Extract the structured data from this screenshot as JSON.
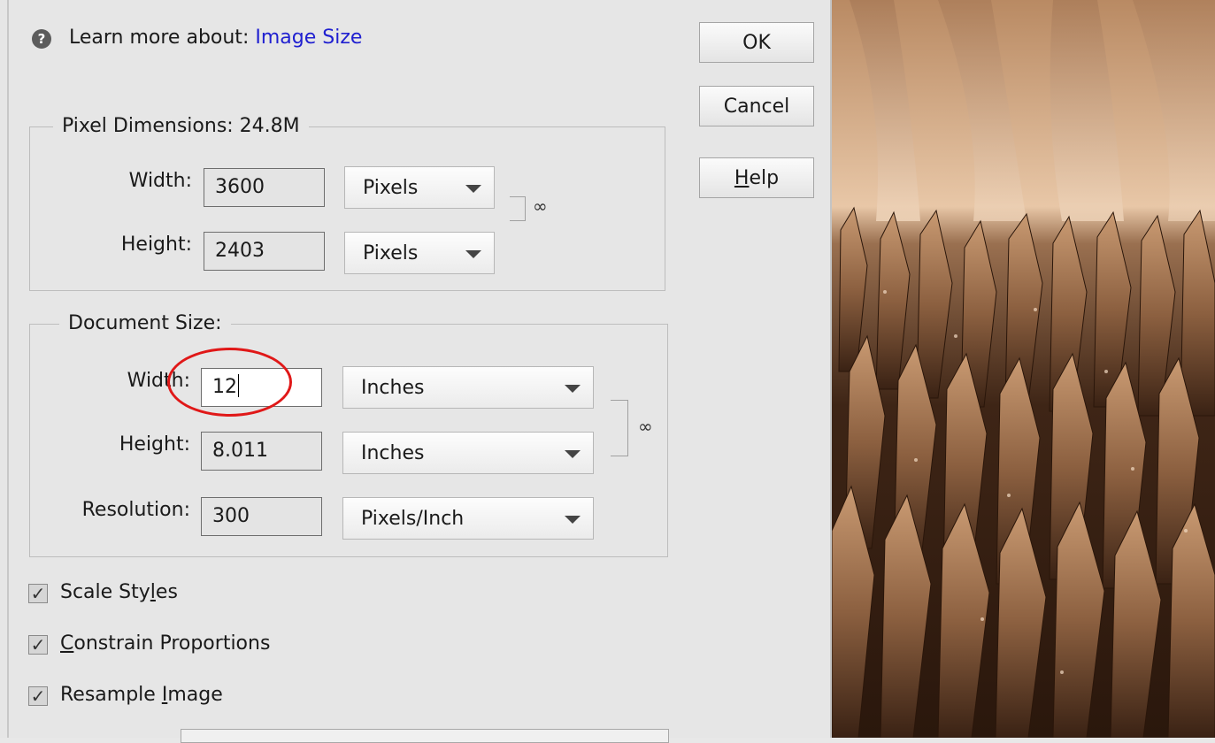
{
  "learn_more": {
    "prefix": "Learn more about:",
    "link": "Image Size"
  },
  "buttons": {
    "ok": "OK",
    "cancel": "Cancel",
    "help_first": "H",
    "help_rest": "elp"
  },
  "pixel_dimensions": {
    "legend": "Pixel Dimensions:  24.8M",
    "width_label": "Width:",
    "width_value": "3600",
    "width_unit": "Pixels",
    "height_label": "Height:",
    "height_value": "2403",
    "height_unit": "Pixels"
  },
  "document_size": {
    "legend": "Document Size:",
    "width_label": "Width:",
    "width_value": "12",
    "width_unit": "Inches",
    "height_label": "Height:",
    "height_value": "8.011",
    "height_unit": "Inches",
    "resolution_label": "Resolution:",
    "resolution_value": "300",
    "resolution_unit": "Pixels/Inch"
  },
  "checkboxes": [
    {
      "before": "Scale Sty",
      "key": "l",
      "after": "es",
      "checked": true
    },
    {
      "before": "",
      "key": "C",
      "after": "onstrain Proportions",
      "checked": true
    },
    {
      "before": "Resample ",
      "key": "I",
      "after": "mage",
      "checked": true
    }
  ],
  "icons": {
    "help": "question-circle-icon",
    "link": "chain-link-icon",
    "dropdown": "triangle-down-icon",
    "check": "checkmark-icon"
  },
  "colors": {
    "link": "#2020d0",
    "highlight_circle": "#e01818",
    "photo_tint": "#c89468"
  }
}
